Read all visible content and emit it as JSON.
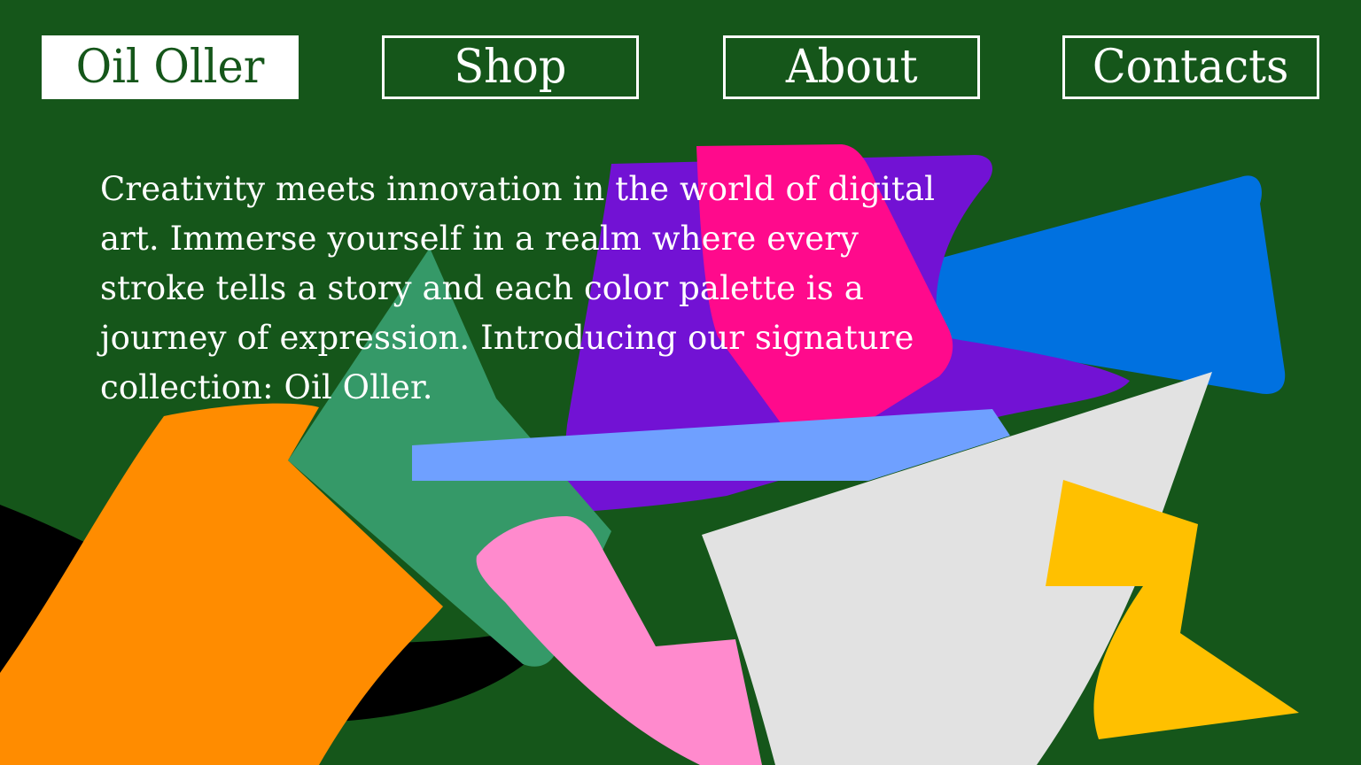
{
  "brand": {
    "label": "Oil Oller"
  },
  "nav": {
    "shop": "Shop",
    "about": "About",
    "contacts": "Contacts"
  },
  "intro": {
    "text": "Creativity meets innovation in the world of digital art. Immerse yourself in a realm where every stroke tells a story and each color palette is a journey of expression. Introducing our signature collection: Oil Oller."
  },
  "colors": {
    "background": "#15561a",
    "nav_text": "#ffffff",
    "brand_text": "#15561a",
    "black": "#000000",
    "orange": "#ff8c00",
    "green": "#359968",
    "purple": "#7212d4",
    "magenta": "#ff0a8c",
    "blue": "#0071e0",
    "light_blue": "#6fa0ff",
    "pink": "#ff8acd",
    "gray": "#e2e2e2",
    "yellow": "#ffc000"
  }
}
